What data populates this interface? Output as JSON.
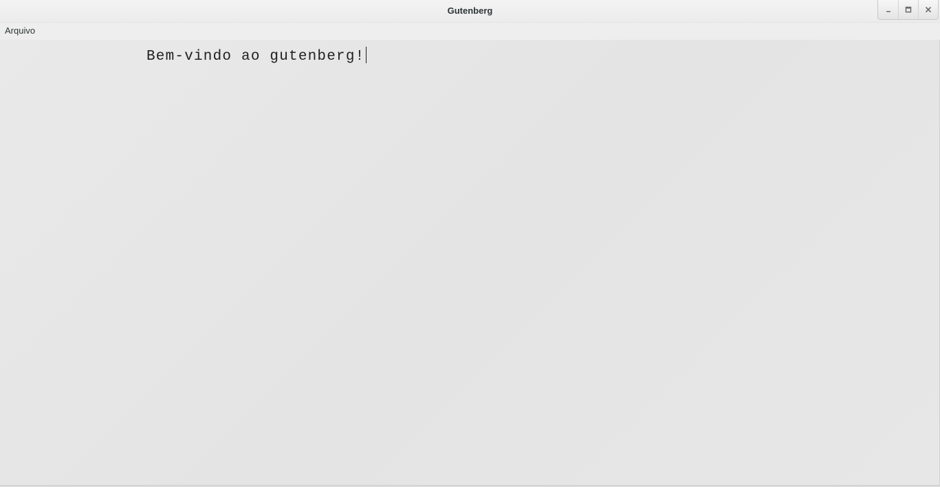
{
  "window": {
    "title": "Gutenberg",
    "controls": {
      "minimize_icon": "minimize-icon",
      "maximize_icon": "maximize-icon",
      "close_icon": "close-icon"
    }
  },
  "menubar": {
    "items": [
      {
        "label": "Arquivo"
      }
    ]
  },
  "editor": {
    "text": "Bem-vindo ao gutenberg!"
  }
}
